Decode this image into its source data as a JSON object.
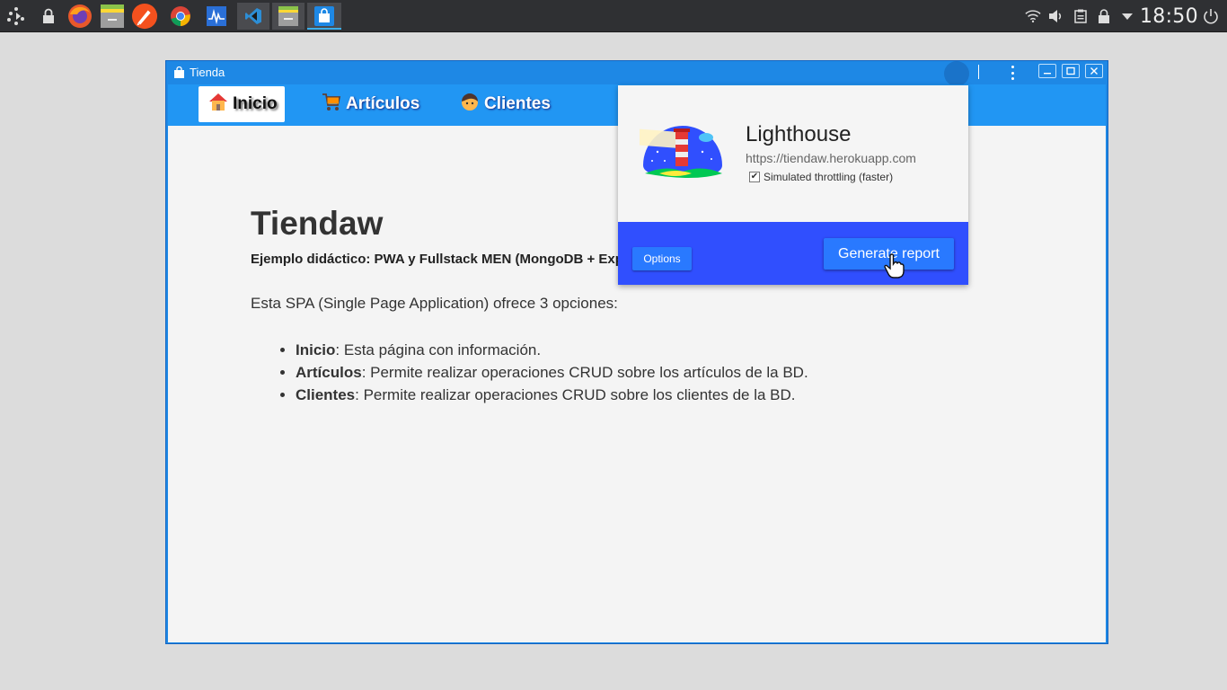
{
  "taskbar": {
    "launchers": [
      "app-launcher-icon",
      "lock-icon",
      "firefox-icon",
      "file-manager-icon",
      "inkscape-pen-icon",
      "chrome-icon",
      "system-monitor-icon",
      "vscode-icon",
      "file-manager-icon",
      "store-bag-icon"
    ],
    "tray": [
      "wifi-icon",
      "volume-icon",
      "clipboard-icon",
      "lock-icon",
      "expand-arrow-icon",
      "power-icon"
    ],
    "clock": "18:50"
  },
  "window": {
    "title": "Tienda",
    "accent": "#2196f3"
  },
  "nav": {
    "items": [
      {
        "label": "Inicio",
        "icon": "house-icon",
        "active": true
      },
      {
        "label": "Artículos",
        "icon": "cart-icon",
        "active": false
      },
      {
        "label": "Clientes",
        "icon": "person-icon",
        "active": false
      }
    ]
  },
  "page": {
    "title": "Tiendaw",
    "subtitle": "Ejemplo didáctico: PWA y Fullstack MEN (MongoDB + Exp",
    "intro": "Esta SPA (Single Page Application) ofrece 3 opciones:",
    "features": [
      {
        "name": "Inicio",
        "desc": ": Esta página con información."
      },
      {
        "name": "Artículos",
        "desc": ": Permite realizar operaciones CRUD sobre los artículos de la BD."
      },
      {
        "name": "Clientes",
        "desc": ": Permite realizar operaciones CRUD sobre los clientes de la BD."
      }
    ]
  },
  "lighthouse": {
    "name": "Lighthouse",
    "url": "https://tiendaw.herokuapp.com",
    "throttling_label": "Simulated throttling (faster)",
    "throttling_checked": true,
    "options_label": "Options",
    "generate_label": "Generate report",
    "footer_color": "#304ffe"
  }
}
